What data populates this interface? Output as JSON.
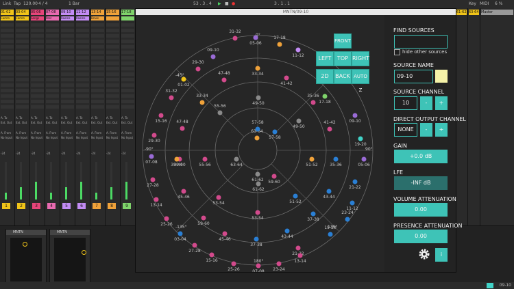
{
  "topbar": {
    "left_items": [
      "Link",
      "Tap",
      "120.00",
      "4 / 4",
      "1 Bar"
    ],
    "position": "53 . 3 . 4",
    "loop": "3 . 1 . 1",
    "right_items": [
      "Key",
      "MIDI",
      "6 %"
    ]
  },
  "tracks": [
    {
      "name": "01-02",
      "color": "#f0c419",
      "clip": "Comm",
      "num": "1"
    },
    {
      "name": "03-04",
      "color": "#f0c419",
      "clip": "Comm",
      "num": "2"
    },
    {
      "name": "05-06",
      "color": "#e6457a",
      "clip": "Songs",
      "num": "3"
    },
    {
      "name": "07-08",
      "color": "#e86ab0",
      "clip": "Perc",
      "num": "4"
    },
    {
      "name": "09-10",
      "color": "#c38cf5",
      "clip": "Rooms",
      "num": "5"
    },
    {
      "name": "11-12",
      "color": "#c38cf5",
      "clip": "Rooms",
      "num": "6"
    },
    {
      "name": "13-14",
      "color": "#f0a23a",
      "clip": "Brass",
      "num": "7"
    },
    {
      "name": "15-16",
      "color": "#f0a23a",
      "clip": "",
      "num": "8"
    },
    {
      "name": "17-18",
      "color": "#7fd36b",
      "clip": "",
      "num": "9"
    }
  ],
  "routing": {
    "audio_to": "A. To",
    "audio_from": "A. From",
    "ext_out": "Ext. Out",
    "no_input": "No Input",
    "vol": "-24"
  },
  "right_tracks": [
    {
      "name": "61-62",
      "color": "#f0c419",
      "num": "31"
    },
    {
      "name": "63-64",
      "color": "#f0c419",
      "num": "32"
    },
    {
      "name": "Master",
      "color": "#999999",
      "num": ""
    }
  ],
  "devices": [
    {
      "title": "MNTN"
    },
    {
      "title": "MNTN"
    }
  ],
  "bottom_status": "09-10",
  "window": {
    "title": "MNTN/09-10"
  },
  "view_buttons": {
    "front": "FRONT",
    "left": "LEFT",
    "top": "TOP",
    "right": "RIGHT",
    "twod": "2D",
    "back": "BACK",
    "autoz": "AUTO Z"
  },
  "ring_labels": {
    "deg0": "0°",
    "deg45": "-45°",
    "deg90": "-90°",
    "deg90r": "90°",
    "deg135": "-135°",
    "deg135r": "135°",
    "deg180": "180°"
  },
  "sources": [
    {
      "label": "31-32",
      "color": "#d24a8c"
    },
    {
      "label": "09-10",
      "color": "#9a6bd6"
    },
    {
      "label": "05-06",
      "color": "#9a6bd6"
    },
    {
      "label": "17-18",
      "color": "#f0a23a"
    },
    {
      "label": "11-12",
      "color": "#c38cf5"
    },
    {
      "label": "29-30",
      "color": "#d24a8c"
    },
    {
      "label": "33-34",
      "color": "#f0a23a"
    },
    {
      "label": "47-48",
      "color": "#d24a8c"
    },
    {
      "label": "01-02",
      "color": "#f0c419"
    },
    {
      "label": "41-42",
      "color": "#d24a8c"
    },
    {
      "label": "31-32",
      "color": "#d24a8c"
    },
    {
      "label": "33-34",
      "color": "#f0a23a"
    },
    {
      "label": "17-18",
      "color": "#7fd36b"
    },
    {
      "label": "49-50",
      "color": "#8a8a8a"
    },
    {
      "label": "35-36",
      "color": "#d24a8c"
    },
    {
      "label": "15-16",
      "color": "#d24a8c"
    },
    {
      "label": "55-56",
      "color": "#8a8a8a"
    },
    {
      "label": "09-10",
      "color": "#9a6bd6"
    },
    {
      "label": "47-48",
      "color": "#d24a8c"
    },
    {
      "label": "49-50",
      "color": "#8a8a8a"
    },
    {
      "label": "41-42",
      "color": "#d24a8c"
    },
    {
      "label": "29-30",
      "color": "#d24a8c"
    },
    {
      "label": "63-64",
      "color": "#f0a23a"
    },
    {
      "label": "57-58",
      "color": "#2a7fd4"
    },
    {
      "label": "57-58",
      "color": "#2a7fd4"
    },
    {
      "label": "19-20",
      "color": "#41d3c8"
    },
    {
      "label": "07-08",
      "color": "#9a6bd6"
    },
    {
      "label": "39-40",
      "color": "#d24a8c"
    },
    {
      "label": "55-56",
      "color": "#d24a8c"
    },
    {
      "label": "63-64",
      "color": "#8a8a8a"
    },
    {
      "label": "51-52",
      "color": "#f0a23a"
    },
    {
      "label": "35-36",
      "color": "#2a7fd4"
    },
    {
      "label": "05-06",
      "color": "#9a6bd6"
    },
    {
      "label": "27-28",
      "color": "#d24a8c"
    },
    {
      "label": "61-62",
      "color": "#8a8a8a"
    },
    {
      "label": "59-60",
      "color": "#d24a8c"
    },
    {
      "label": "21-22",
      "color": "#2a7fd4"
    },
    {
      "label": "45-46",
      "color": "#d24a8c"
    },
    {
      "label": "61-62",
      "color": "#8a8a8a"
    },
    {
      "label": "53-54",
      "color": "#d24a8c"
    },
    {
      "label": "43-44",
      "color": "#2a7fd4"
    },
    {
      "label": "13-14",
      "color": "#d24a8c"
    },
    {
      "label": "51-52",
      "color": "#2a7fd4"
    },
    {
      "label": "11-12",
      "color": "#2a7fd4"
    },
    {
      "label": "25-26",
      "color": "#d24a8c"
    },
    {
      "label": "53-54",
      "color": "#d24a8c"
    },
    {
      "label": "59-60",
      "color": "#d24a8c"
    },
    {
      "label": "37-38",
      "color": "#2a7fd4"
    },
    {
      "label": "23-24",
      "color": "#2a7fd4"
    },
    {
      "label": "45-46",
      "color": "#d24a8c"
    },
    {
      "label": "43-44",
      "color": "#2a7fd4"
    },
    {
      "label": "03-04",
      "color": "#2a7fd4"
    },
    {
      "label": "19-20",
      "color": "#2a7fd4"
    },
    {
      "label": "27-28",
      "color": "#d24a8c"
    },
    {
      "label": "37-38",
      "color": "#2a7fd4"
    },
    {
      "label": "21-22",
      "color": "#d24a8c"
    },
    {
      "label": "15-16",
      "color": "#d24a8c"
    },
    {
      "label": "13-14",
      "color": "#d24a8c"
    },
    {
      "label": "25-26",
      "color": "#d24a8c"
    },
    {
      "label": "07-08",
      "color": "#d24a8c"
    },
    {
      "label": "23-24",
      "color": "#d24a8c"
    },
    {
      "label": "39-40",
      "color": "#f0a23a"
    }
  ],
  "find_sources": {
    "label": "FIND SOURCES",
    "value": "",
    "hide_other": "hide other sources"
  },
  "source_name": {
    "label": "SOURCE NAME",
    "value": "09-10",
    "swatch_color": "#f5f2a8"
  },
  "source_channel": {
    "label": "SOURCE CHANNEL",
    "value": "10",
    "minus": "-",
    "plus": "+"
  },
  "direct_output": {
    "label": "DIRECT OUTPUT CHANNEL",
    "value": "NONE",
    "minus": "-",
    "plus": "+"
  },
  "gain": {
    "label": "GAIN",
    "value": "+0.0 dB"
  },
  "lfe": {
    "label": "LFE",
    "value": "-INF dB"
  },
  "volume_attenuation": {
    "label": "VOLUME ATTENUATION",
    "value": "0.00"
  },
  "presence_attenuation": {
    "label": "PRESENCE ATTENUATION",
    "value": "0.00"
  },
  "info_button": {
    "label": "i"
  }
}
